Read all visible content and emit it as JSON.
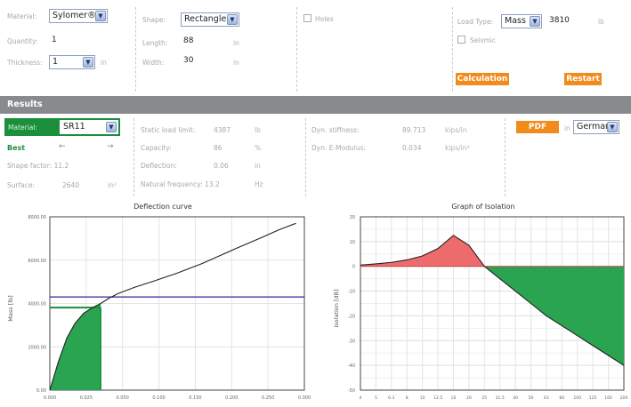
{
  "input": {
    "material_label": "Material:",
    "material_value": "Sylomer®",
    "quantity_label": "Quantity:",
    "quantity_value": "1",
    "thickness_label": "Thickness:",
    "thickness_value": "1",
    "thickness_unit": "in",
    "shape_label": "Shape:",
    "shape_value": "Rectangle",
    "length_label": "Length:",
    "length_value": "88",
    "length_unit": "in",
    "width_label": "Width:",
    "width_value": "30",
    "width_unit": "in",
    "holes_label": "Holes",
    "load_type_label": "Load Type:",
    "load_type_value": "Mass",
    "load_value": "3810",
    "load_unit": "lb",
    "seismic_label": "Seismic",
    "calculation_label": "Calculation",
    "restart_label": "Restart"
  },
  "results": {
    "header": "Results",
    "material_label": "Material:",
    "material_value": "SR11",
    "best_label": "Best",
    "best_left_arrow": "←",
    "best_right_arrow": "→",
    "shape_factor_label": "Shape factor: 11.2",
    "surface_label": "Surface:",
    "surface_value": "2640",
    "surface_unit": "in²",
    "static_load_label": "Static load limit:",
    "static_load_value": "4387",
    "static_load_unit": "lb",
    "capacity_label": "Capacity:",
    "capacity_value": "86",
    "capacity_unit": "%",
    "deflection_label": "Deflection:",
    "deflection_value": "0.06",
    "deflection_unit": "in",
    "nat_freq_label": "Natural frequency: 13.2",
    "nat_freq_unit": "Hz",
    "dyn_stiffness_label": "Dyn. stiffness:",
    "dyn_stiffness_value": "89.713",
    "dyn_stiffness_unit": "kips/in",
    "dyn_emod_label": "Dyn. E-Modulus:",
    "dyn_emod_value": "0.034",
    "dyn_emod_unit": "kips/in²",
    "pdf_label": "PDF",
    "in_label": "in",
    "language_value": "German"
  },
  "colors": {
    "accent_orange": "#f08b1c",
    "results_bar": "#888a8c",
    "green": "#1b8f3c",
    "red_fill": "#ee6b6b",
    "blue_line": "#3a3aa0"
  },
  "chart_data": [
    {
      "type": "line",
      "title": "Deflection curve",
      "ylabel": "Mass [lb]",
      "xlabel": "",
      "x_ticks": [
        "0.000",
        "0.025",
        "0.050",
        "0.100",
        "0.150",
        "0.200",
        "0.250",
        "0.300"
      ],
      "y_ticks": [
        "0.00",
        "2000.00",
        "4000.00",
        "6000.00",
        "8000.00"
      ],
      "ylim": [
        0,
        8000
      ],
      "grid": true,
      "series": [
        {
          "x": [
            0,
            0.01,
            0.02,
            0.03,
            0.04,
            0.05,
            0.06,
            0.07,
            0.08,
            0.1,
            0.12,
            0.15,
            0.18,
            0.2,
            0.22,
            0.25,
            0.27,
            0.29
          ],
          "y": [
            0,
            1300,
            2400,
            3100,
            3550,
            3800,
            4000,
            4250,
            4450,
            4750,
            5000,
            5400,
            5850,
            6200,
            6550,
            7050,
            7400,
            7700
          ]
        }
      ],
      "load_line_y": 4300,
      "operating_point": {
        "x": 0.06,
        "y": 3810
      }
    },
    {
      "type": "area",
      "title": "Graph of Isolation",
      "ylabel": "Isolation [dB]",
      "x_ticks": [
        "4",
        "5",
        "6.3",
        "8",
        "10",
        "12.5",
        "16",
        "20",
        "25",
        "31.5",
        "40",
        "50",
        "63",
        "80",
        "100",
        "125",
        "160",
        "200"
      ],
      "y_ticks": [
        "20",
        "10",
        "0",
        "-10",
        "-20",
        "-30",
        "-40",
        "-50"
      ],
      "ylim": [
        -50,
        20
      ],
      "grid": true,
      "series": [
        {
          "name": "",
          "x": [
            0,
            1,
            2,
            3,
            4,
            5,
            6,
            7,
            8,
            9,
            10,
            11,
            12,
            13,
            14,
            15,
            16,
            17
          ],
          "y": [
            0.5,
            1,
            1.6,
            2.6,
            4.2,
            7.2,
            12.5,
            8.5,
            0,
            -5,
            -10,
            -15,
            -20,
            -24,
            -28,
            -32,
            -36,
            -40
          ]
        }
      ]
    }
  ]
}
